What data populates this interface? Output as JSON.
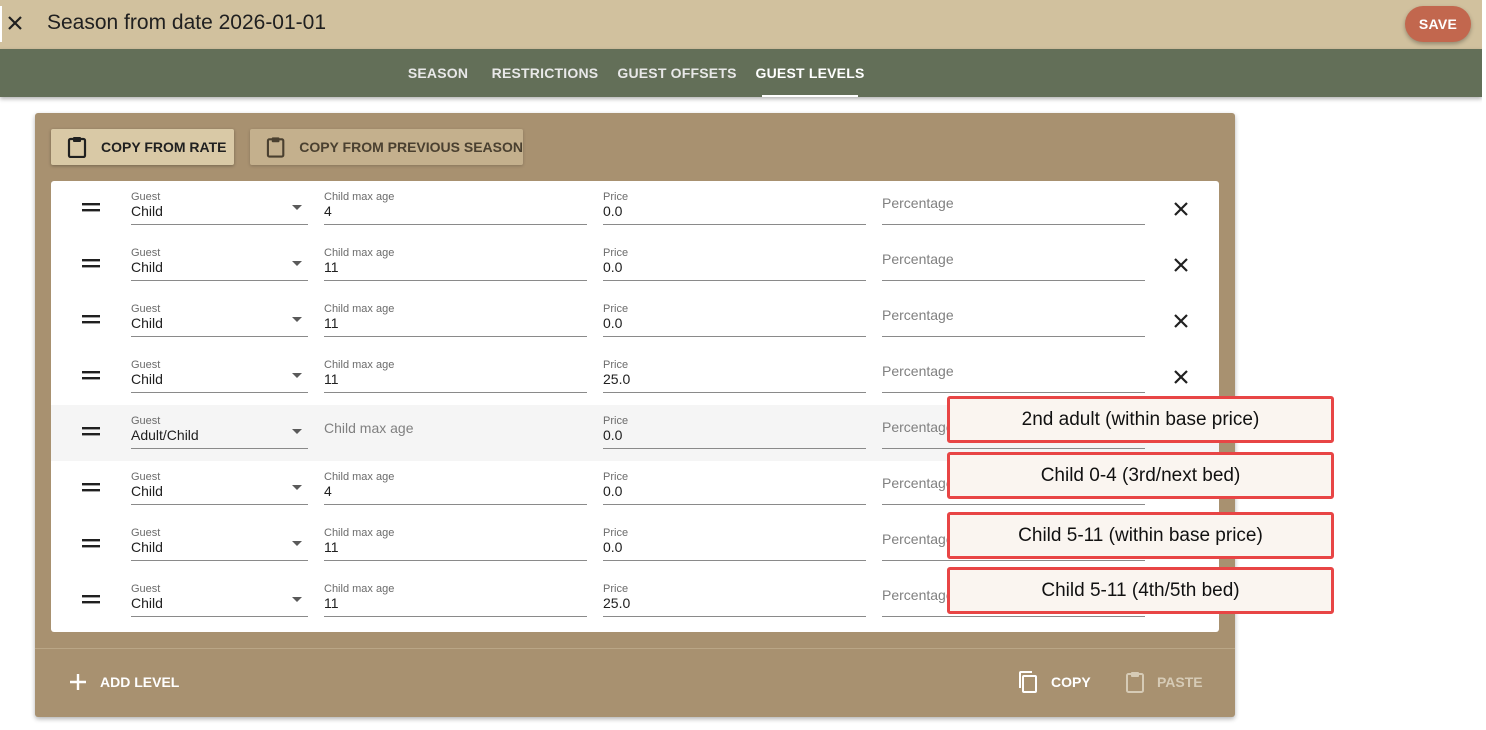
{
  "header": {
    "title": "Season from date 2026-01-01",
    "save_label": "SAVE",
    "close_icon": "close-icon"
  },
  "tabs": [
    {
      "label": "SEASON",
      "active": false
    },
    {
      "label": "RESTRICTIONS",
      "active": false
    },
    {
      "label": "GUEST OFFSETS",
      "active": false
    },
    {
      "label": "GUEST LEVELS",
      "active": true
    }
  ],
  "panel": {
    "copy_from_rate": "COPY FROM RATE",
    "copy_from_previous": "COPY FROM PREVIOUS SEASON",
    "field_labels": {
      "guest": "Guest",
      "child_max_age": "Child max age",
      "price": "Price",
      "percentage": "Percentage"
    },
    "levels": [
      {
        "guest": "Child",
        "child_max_age": "4",
        "price": "0.0",
        "percentage": ""
      },
      {
        "guest": "Child",
        "child_max_age": "11",
        "price": "0.0",
        "percentage": ""
      },
      {
        "guest": "Child",
        "child_max_age": "11",
        "price": "0.0",
        "percentage": ""
      },
      {
        "guest": "Child",
        "child_max_age": "11",
        "price": "25.0",
        "percentage": ""
      },
      {
        "guest": "Adult/Child",
        "child_max_age": "",
        "price": "0.0",
        "percentage": ""
      },
      {
        "guest": "Child",
        "child_max_age": "4",
        "price": "0.0",
        "percentage": ""
      },
      {
        "guest": "Child",
        "child_max_age": "11",
        "price": "0.0",
        "percentage": ""
      },
      {
        "guest": "Child",
        "child_max_age": "11",
        "price": "25.0",
        "percentage": ""
      }
    ],
    "footer": {
      "add_level": "ADD LEVEL",
      "copy": "COPY",
      "paste": "PASTE"
    }
  },
  "annotations": [
    "2nd adult (within base price)",
    "Child 0-4 (3rd/next bed)",
    "Child 5-11 (within base price)",
    "Child 5-11 (4th/5th bed)"
  ],
  "colors": {
    "header_bg": "#d1c19e",
    "tabbar_bg": "#636f58",
    "panel_bg": "#a89170",
    "save_bg": "#c2674e",
    "annotation_border": "#e84545"
  }
}
